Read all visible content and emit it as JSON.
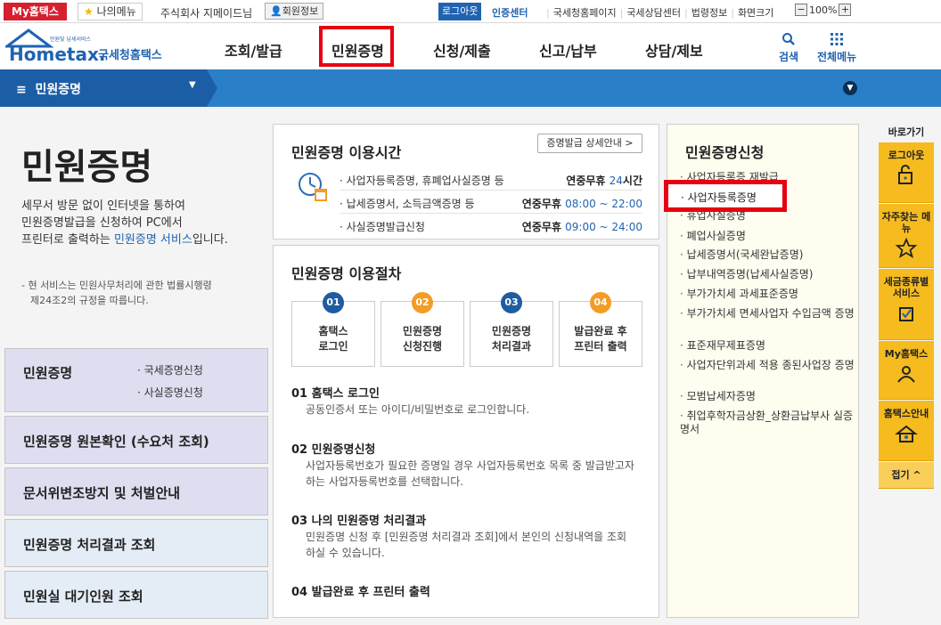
{
  "topbar": {
    "my_label": "My홈택스",
    "fav_label": "나의메뉴",
    "company": "주식회사 지메이드님",
    "member": "회원정보",
    "logout": "로그아웃",
    "cert": "인증센터",
    "links": [
      "국세청홈페이지",
      "국세상담센터",
      "법령정보",
      "화면크기"
    ],
    "zoom": "100%"
  },
  "header": {
    "logo_small": "민원및 납세서비스",
    "logo_brand": "Hometax.",
    "logo_name": "국세청홈택스",
    "nav": [
      "조회/발급",
      "민원증명",
      "신청/제출",
      "신고/납부",
      "상담/제보"
    ],
    "search": "검색",
    "allmenu": "전체메뉴"
  },
  "subbar": {
    "title": "민원증명"
  },
  "left": {
    "title": "민원증명",
    "desc": [
      "세무서 방문 없이 인터넷을 통하여",
      "민원증명발급을 신청하여 PC에서",
      "프린터로 출력하는 "
    ],
    "desc_link": "민원증명 서비스",
    "desc_tail": "입니다.",
    "note": [
      "- 현 서비스는 민원사무처리에 관한 법률시행령",
      "제24조2의 규정을 따릅니다."
    ],
    "box1_title": "민원증명",
    "box1_subs": [
      "· 국세증명신청",
      "· 사실증명신청"
    ],
    "box2": "민원증명 원본확인 (수요처 조회)",
    "box3": "문서위변조방지 및 처벌안내",
    "box4": "민원증명 처리결과 조회",
    "box5": "민원실 대기인원 조회"
  },
  "time": {
    "title": "민원증명 이용시간",
    "btn": "증명발급 상세안내 >",
    "rows": [
      {
        "l": "· 사업자등록증명, 휴폐업사실증명 등",
        "r1": "연중무휴 ",
        "r2": "24",
        "r3": "시간"
      },
      {
        "l": "· 납세증명서, 소득금액증명 등",
        "r1": "연중무휴 ",
        "r2": "08:00 ~ 22:00",
        "r3": ""
      },
      {
        "l": "· 사실증명발급신청",
        "r1": "연중무휴 ",
        "r2": "09:00 ~ 24:00",
        "r3": ""
      }
    ]
  },
  "proc": {
    "title": "민원증명 이용절차",
    "steps": [
      {
        "n": "01",
        "t1": "홈택스",
        "t2": "로그인"
      },
      {
        "n": "02",
        "t1": "민원증명",
        "t2": "신청진행"
      },
      {
        "n": "03",
        "t1": "민원증명",
        "t2": "처리결과"
      },
      {
        "n": "04",
        "t1": "발급완료 후",
        "t2": "프린터 출력"
      }
    ],
    "sections": [
      {
        "h": "01 홈택스 로그인",
        "d": [
          "공동인증서 또는 아이디/비밀번호로 로그인합니다."
        ]
      },
      {
        "h": "02 민원증명신청",
        "d": [
          "사업자등록번호가 필요한 증명일 경우 사업자등록번호 목록 중 발급받고자",
          "하는 사업자등록번호를 선택합니다."
        ]
      },
      {
        "h": "03 나의 민원증명 처리결과",
        "d": [
          "민원증명 신청 후 [민원증명 처리결과 조회]에서 본인의 신청내역을 조회",
          "하실 수 있습니다."
        ]
      },
      {
        "h": "04 발급완료 후 프린터 출력",
        "d": []
      }
    ]
  },
  "apply": {
    "title": "민원증명신청",
    "items": [
      "사업자등록증 재발급",
      "사업자등록증명",
      "휴업사실증명",
      "폐업사실증명",
      "납세증명서(국세완납증명)",
      "납부내역증명(납세사실증명)",
      "부가가치세 과세표준증명",
      "부가가치세 면세사업자 수입금액 증명",
      "표준재무제표증명",
      "사업자단위과세 적용 종된사업장 증명",
      "모범납세자증명",
      "취업후학자금상환_상환금납부사 실증명서"
    ],
    "highlight": "· 사업자등록증명"
  },
  "quick": {
    "title": "바로가기",
    "items": [
      "로그아웃",
      "자주찾는 메뉴",
      "세금종류별 서비스",
      "My홈택스",
      "홈택스안내"
    ],
    "fold": "접기 ^"
  },
  "colors": {
    "primary": "#1f63b1",
    "subbar": "#2b7fc9",
    "highlight": "#e60012",
    "quick": "#f5bb1f",
    "my": "#d61f2f"
  }
}
